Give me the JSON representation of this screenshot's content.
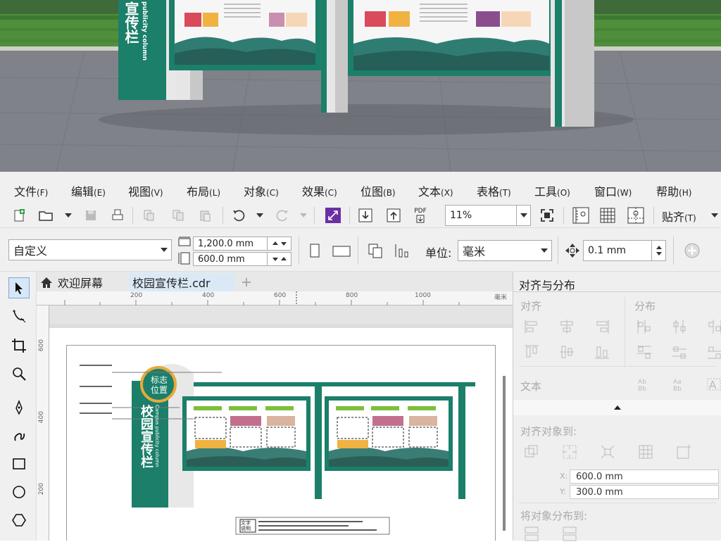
{
  "menubar": {
    "items": [
      {
        "label": "文件",
        "acc": "(F)"
      },
      {
        "label": "编辑",
        "acc": "(E)"
      },
      {
        "label": "视图",
        "acc": "(V)"
      },
      {
        "label": "布局",
        "acc": "(L)"
      },
      {
        "label": "对象",
        "acc": "(C)"
      },
      {
        "label": "效果",
        "acc": "(C)"
      },
      {
        "label": "位图",
        "acc": "(B)"
      },
      {
        "label": "文本",
        "acc": "(X)"
      },
      {
        "label": "表格",
        "acc": "(T)"
      },
      {
        "label": "工具",
        "acc": "(O)"
      },
      {
        "label": "窗口",
        "acc": "(W)"
      },
      {
        "label": "帮助",
        "acc": "(H)"
      }
    ]
  },
  "toolbar": {
    "zoom_value": "11%",
    "pdf_label": "PDF",
    "snap_label": "贴齐",
    "snap_acc": "(T)"
  },
  "propbar": {
    "page_preset": "自定义",
    "width_value": "1,200.0 mm",
    "height_value": "600.0 mm",
    "unit_label": "单位:",
    "unit_value": "毫米",
    "nudge_value": "0.1 mm"
  },
  "tabs": {
    "welcome_label": "欢迎屏幕",
    "doc_label": "校园宣传栏.cdr"
  },
  "ruler": {
    "h_labels": [
      "200",
      "400",
      "600",
      "800",
      "1000"
    ],
    "h_unit": "毫米",
    "v_labels": [
      "600",
      "400",
      "200"
    ]
  },
  "artwork": {
    "logo_text_1": "标志",
    "logo_text_2": "位置",
    "pillar_title": "校园宣传栏",
    "pillar_sub": "Campus publicity column",
    "caption_label": "文字说明"
  },
  "photo": {
    "pillar_title": "宣传栏",
    "pillar_sub": "publicity column"
  },
  "docker": {
    "title": "对齐与分布",
    "align_label": "对齐",
    "distribute_label": "分布",
    "text_label": "文本",
    "align_to_label": "对齐对象到:",
    "x_label": "X:",
    "x_value": "600.0 mm",
    "y_label": "Y:",
    "y_value": "300.0 mm",
    "distribute_to_label": "将对象分布到:"
  },
  "colors": {
    "brand_green": "#1b7f6a",
    "logo_ring": "#e8a93a"
  }
}
